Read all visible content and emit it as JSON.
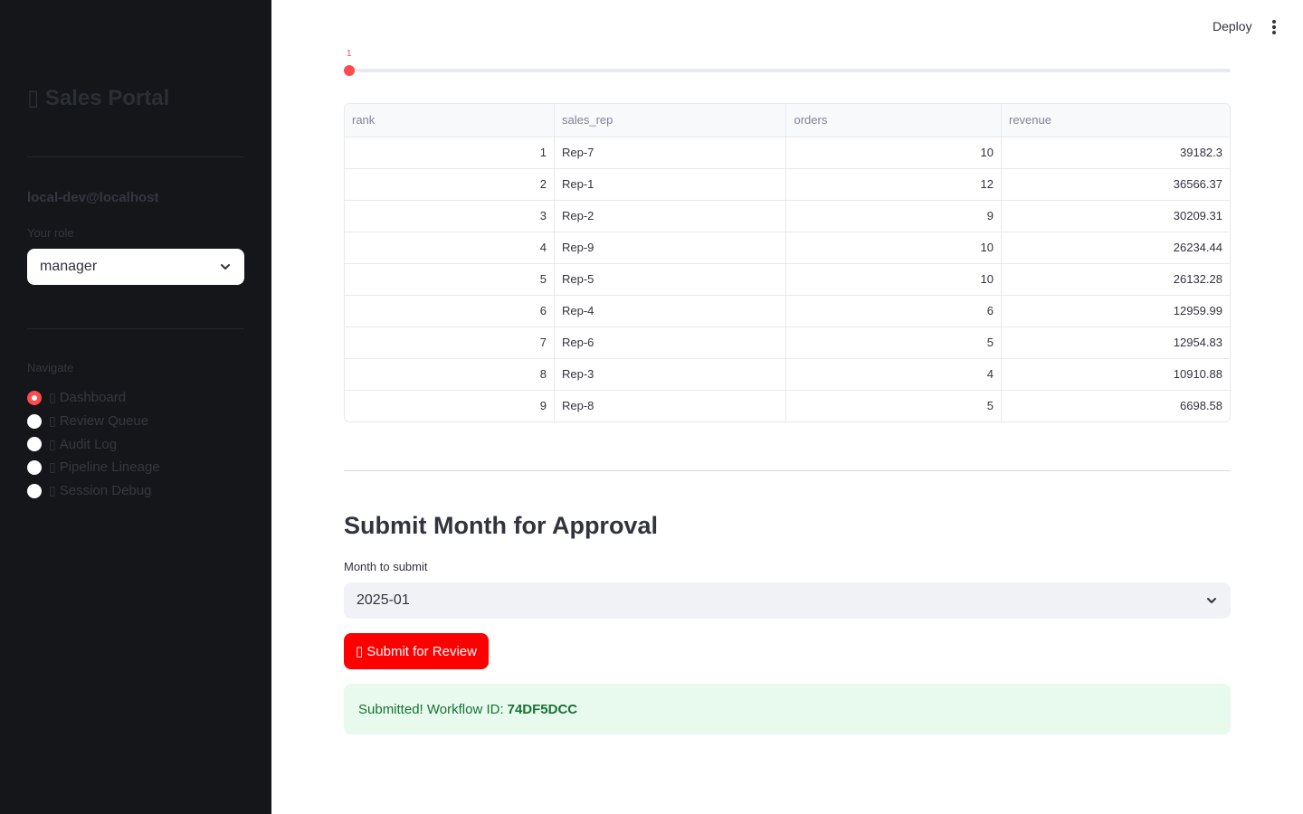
{
  "sidebar": {
    "app_title": "▯ Sales Portal",
    "user_email": "local-dev@localhost",
    "role_label": "Your role",
    "role_value": "manager",
    "nav_label": "Navigate",
    "nav_items": [
      {
        "glyph": "▯",
        "label": "Dashboard",
        "selected": true
      },
      {
        "glyph": "▯",
        "label": "Review Queue",
        "selected": false
      },
      {
        "glyph": "▯",
        "label": "Audit Log",
        "selected": false
      },
      {
        "glyph": "▯",
        "label": "Pipeline Lineage",
        "selected": false
      },
      {
        "glyph": "▯",
        "label": "Session Debug",
        "selected": false
      }
    ]
  },
  "header": {
    "deploy_label": "Deploy",
    "menu_icon": "kebab-menu-icon"
  },
  "slider": {
    "value": "1",
    "fraction": 0
  },
  "table": {
    "columns": [
      "rank",
      "sales_rep",
      "orders",
      "revenue"
    ],
    "rows": [
      [
        "1",
        "Rep-7",
        "10",
        "39182.3"
      ],
      [
        "2",
        "Rep-1",
        "12",
        "36566.37"
      ],
      [
        "3",
        "Rep-2",
        "9",
        "30209.31"
      ],
      [
        "4",
        "Rep-9",
        "10",
        "26234.44"
      ],
      [
        "5",
        "Rep-5",
        "10",
        "26132.28"
      ],
      [
        "6",
        "Rep-4",
        "6",
        "12959.99"
      ],
      [
        "7",
        "Rep-6",
        "5",
        "12954.83"
      ],
      [
        "8",
        "Rep-3",
        "4",
        "10910.88"
      ],
      [
        "9",
        "Rep-8",
        "5",
        "6698.58"
      ]
    ]
  },
  "submit_section": {
    "title": "Submit Month for Approval",
    "month_label": "Month to submit",
    "month_value": "2025-01",
    "button_glyph": "▯",
    "button_label": "Submit for Review",
    "success_prefix": "Submitted! Workflow ID:",
    "workflow_id": "74DF5DCC"
  },
  "colors": {
    "accent": "#ff4b4b",
    "primary_button": "#ff0000",
    "sidebar_bg": "#14161a",
    "success_bg": "#e8f9ee",
    "success_text": "#177233"
  }
}
